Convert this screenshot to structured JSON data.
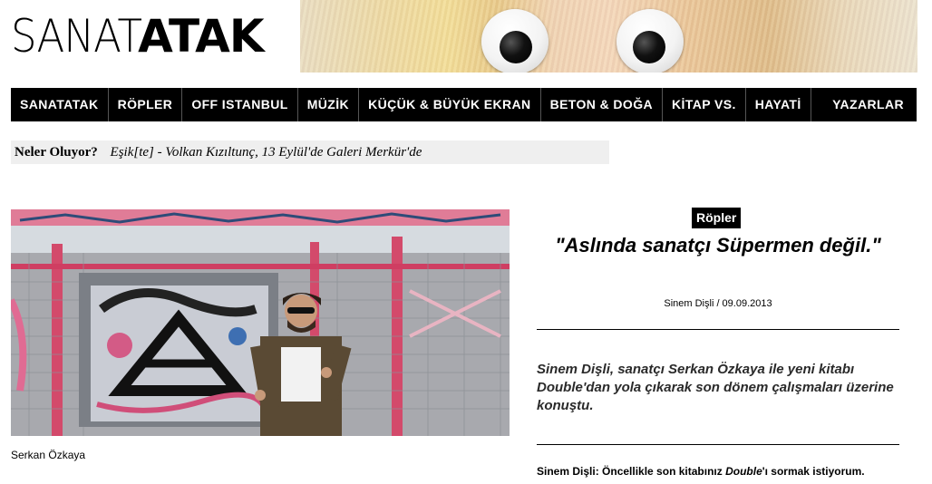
{
  "site": {
    "logo_light": "SANAT",
    "logo_bold": "ATAK"
  },
  "nav": {
    "items": [
      {
        "label": "SANATATAK"
      },
      {
        "label": "RÖPLER"
      },
      {
        "label": "OFF ISTANBUL"
      },
      {
        "label": "MÜZİK"
      },
      {
        "label": "KÜÇÜK & BÜYÜK EKRAN"
      },
      {
        "label": "BETON & DOĞA"
      },
      {
        "label": "KİTAP VS."
      },
      {
        "label": "HAYATİ"
      }
    ],
    "writers": "YAZARLAR"
  },
  "ticker": {
    "label": "Neler Oluyor?",
    "news": "Eşik[te] - Volkan Kızıltunç, 13 Eylül'de Galeri Merkür'de"
  },
  "article": {
    "image_caption": "Serkan Özkaya",
    "category": "Röpler",
    "title": "\"Aslında sanatçı Süpermen değil.\"",
    "byline": "Sinem Dişli / 09.09.2013",
    "lead": "Sinem Dişli, sanatçı Serkan Özkaya ile yeni kitabı Double'dan yola çıkarak son dönem çalışmaları üzerine konuştu.",
    "first_q_speaker": "Sinem Dişli:",
    "first_q_pre": "Öncellikle son kitabınız",
    "first_q_italic": "Double",
    "first_q_post": "'ı sormak istiyorum."
  },
  "colors": {
    "nav_bg": "#000000",
    "ticker_bg": "#efefef",
    "graffiti_pink": "#e0748f"
  }
}
